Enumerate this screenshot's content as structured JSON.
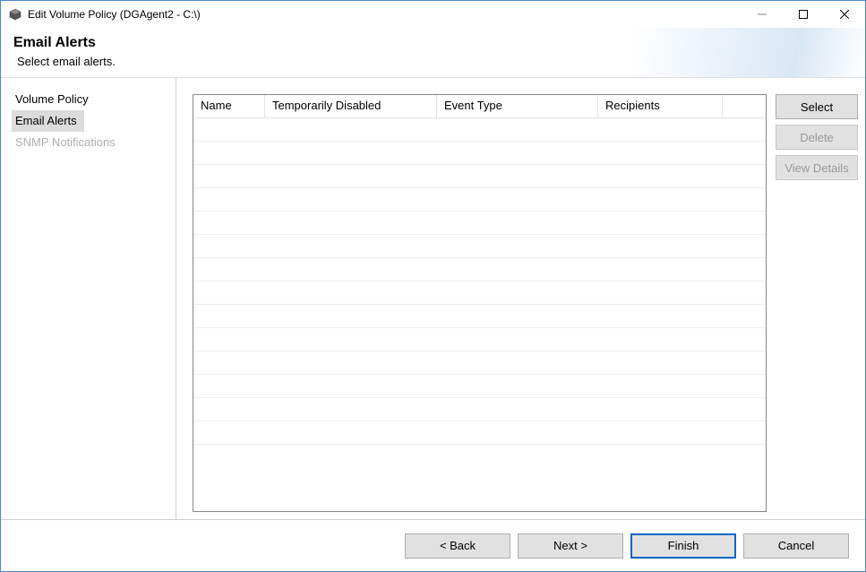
{
  "window": {
    "title": "Edit Volume Policy (DGAgent2 - C:\\)"
  },
  "banner": {
    "heading": "Email Alerts",
    "subtitle": "Select email alerts."
  },
  "sidebar": {
    "items": [
      {
        "label": "Volume Policy",
        "selected": false,
        "disabled": false
      },
      {
        "label": "Email Alerts",
        "selected": true,
        "disabled": false
      },
      {
        "label": "SNMP Notifications",
        "selected": false,
        "disabled": true
      }
    ]
  },
  "table": {
    "columns": [
      {
        "label": "Name"
      },
      {
        "label": "Temporarily Disabled"
      },
      {
        "label": "Event Type"
      },
      {
        "label": "Recipients"
      }
    ],
    "rows": []
  },
  "side_buttons": {
    "select": "Select",
    "delete": "Delete",
    "view_details": "View Details"
  },
  "footer": {
    "back": "< Back",
    "next": "Next >",
    "finish": "Finish",
    "cancel": "Cancel"
  }
}
